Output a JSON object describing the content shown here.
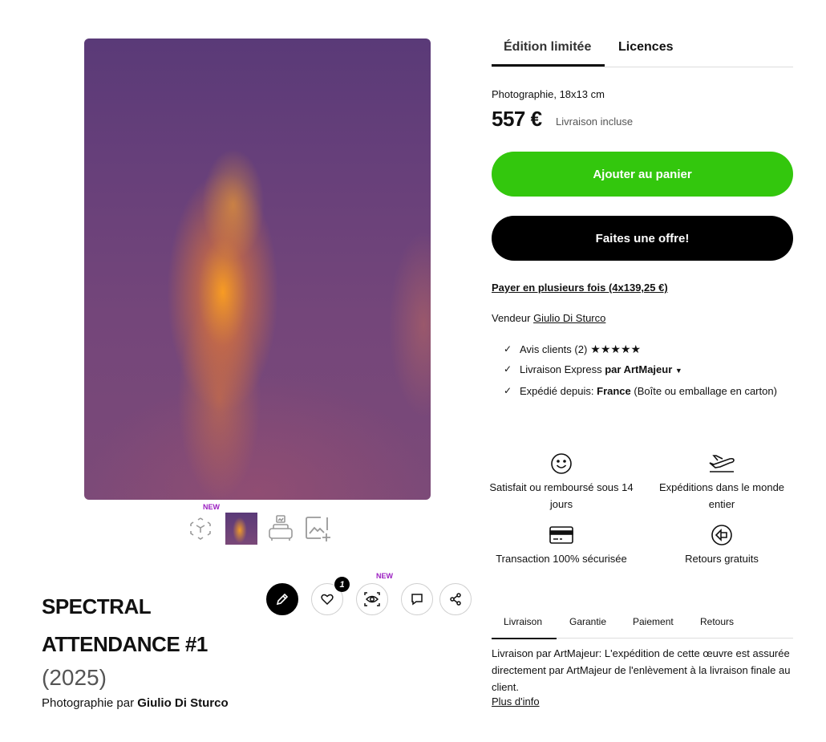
{
  "artwork": {
    "new_badge": "NEW",
    "thumbnails": [
      "ar-view-icon",
      "artwork-thumbnail",
      "room-view-icon",
      "add-image-icon"
    ]
  },
  "actions": {
    "favorites_count": "1",
    "view_new_badge": "NEW"
  },
  "title": "SPECTRAL ATTENDANCE #1",
  "year": "(2025)",
  "byline": {
    "prefix": "Photographie par",
    "artist": "Giulio Di Sturco"
  },
  "tabs": [
    "Édition limitée",
    "Licences"
  ],
  "medium": "Photographie, 18x13 cm",
  "price": "557 €",
  "price_note": "Livraison incluse",
  "buttons": {
    "cart": "Ajouter au panier",
    "offer": "Faites une offre!"
  },
  "installments": "Payer en plusieurs fois (4x139,25 €)",
  "seller": {
    "label": "Vendeur",
    "name": "Giulio Di Sturco"
  },
  "features": {
    "reviews": "Avis clients (2)",
    "stars": "★★★★★",
    "express_prefix": "Livraison Express",
    "express_bold": "par ArtMajeur",
    "shipped_prefix": "Expédié depuis:",
    "shipped_country": "France",
    "shipped_suffix": "(Boîte ou emballage en carton)"
  },
  "guarantees": [
    {
      "icon": "smiley-icon",
      "text": "Satisfait ou remboursé sous 14 jours"
    },
    {
      "icon": "plane-icon",
      "text": "Expéditions dans le monde entier"
    },
    {
      "icon": "credit-card-icon",
      "text": "Transaction 100% sécurisée"
    },
    {
      "icon": "return-arrow-icon",
      "text": "Retours gratuits"
    }
  ],
  "subtabs": [
    "Livraison",
    "Garantie",
    "Paiement",
    "Retours"
  ],
  "delivery_text": "Livraison par ArtMajeur: L'expédition de cette œuvre est assurée directement par ArtMajeur de l'enlèvement à la livraison finale au client.",
  "more_info": "Plus d'info",
  "colors": {
    "cart_button": "#33c70d",
    "offer_button": "#000000",
    "new_badge": "#9b1fc1"
  }
}
